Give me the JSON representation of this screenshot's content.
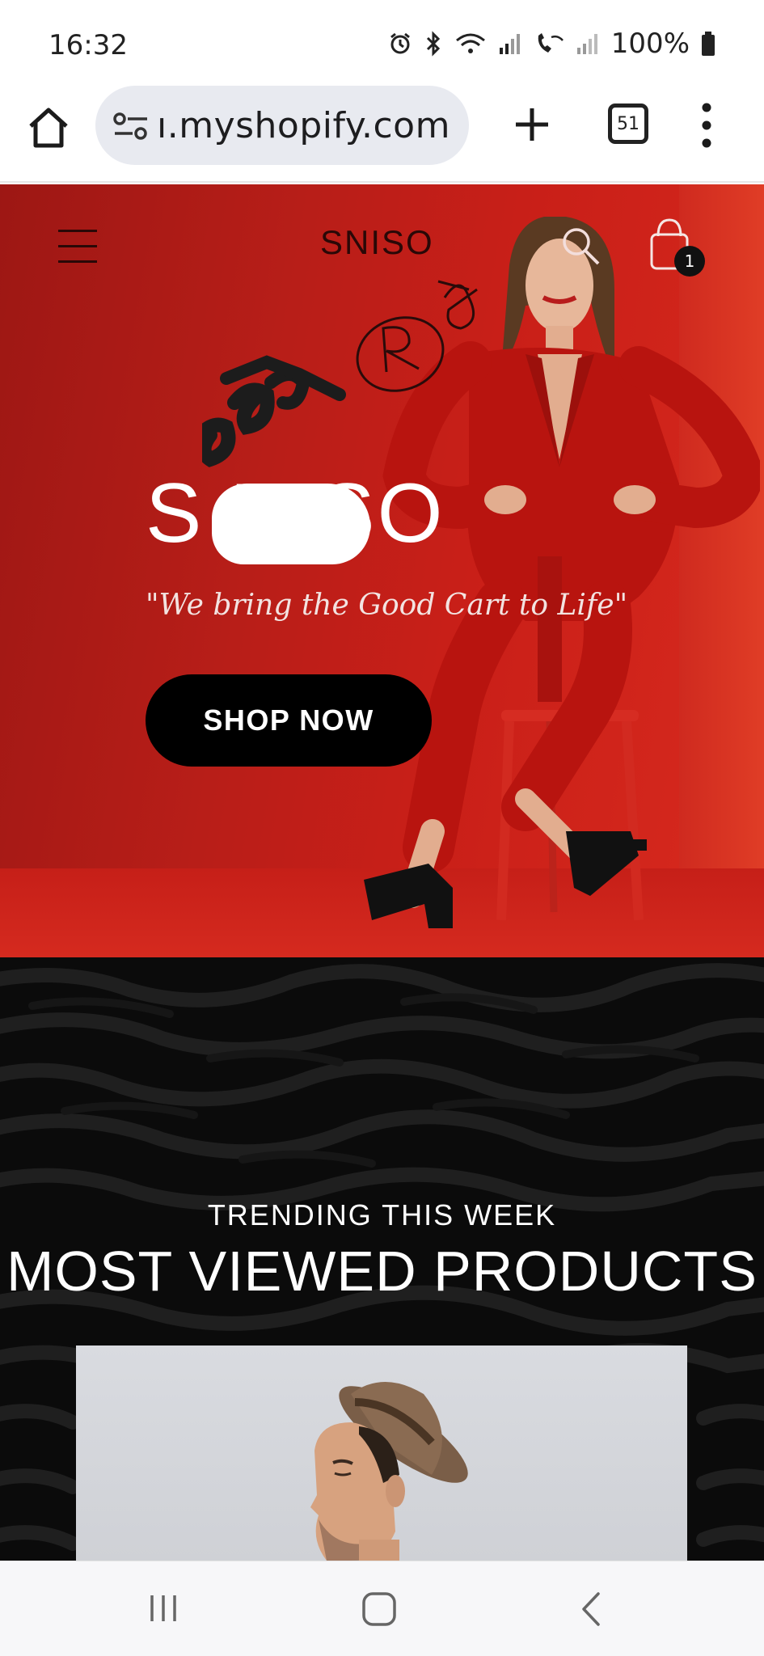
{
  "status_bar": {
    "time": "16:32",
    "battery_text": "100%",
    "icons": [
      "alarm-icon",
      "bluetooth-icon",
      "wifi-icon",
      "signal-icon",
      "wifi-calling-icon",
      "signal-icon",
      "battery-icon"
    ]
  },
  "browser": {
    "url": "ı.myshopify.com",
    "tab_count": "51",
    "icons": [
      "home-icon",
      "tune-icon",
      "plus-icon",
      "tabs-icon",
      "more-vert-icon"
    ]
  },
  "hero": {
    "brand_logo": "SNISO",
    "title": "S      NISO",
    "tagline": "\"We bring the Good Cart to Life\"",
    "cta_label": "SHOP NOW",
    "cart_count": "1",
    "background_color": "#c01f18"
  },
  "trending": {
    "eyebrow": "TRENDING THIS WEEK",
    "title": "MOST VIEWED PRODUCTS",
    "background_color": "#0b0b0b"
  },
  "nav": {
    "icons": [
      "recents-icon",
      "home-icon",
      "back-icon"
    ]
  }
}
